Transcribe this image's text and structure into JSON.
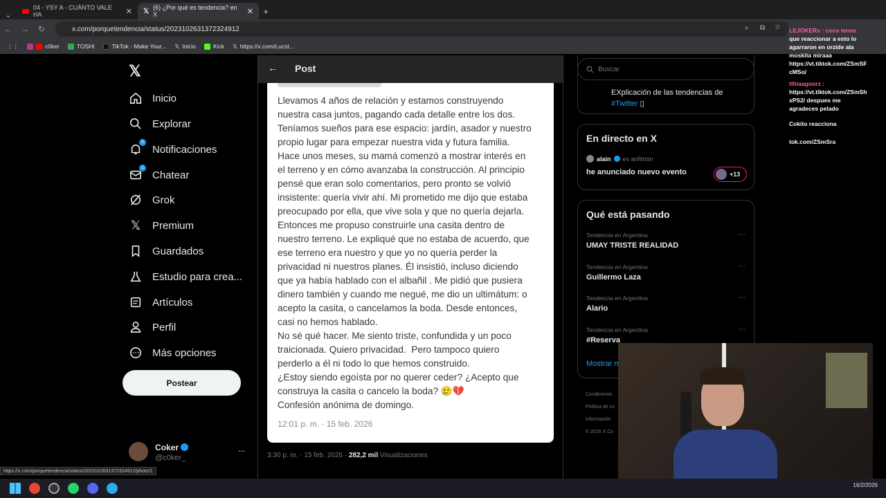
{
  "browser": {
    "tabs": [
      {
        "label": "04 - YSY A - CUÁNTO VALE HA",
        "icon": "youtube-icon"
      },
      {
        "label": "(6) ¿Por qué es tendencia? en X",
        "icon": "x-icon"
      }
    ],
    "new_tab": "+",
    "url": "x.com/porquetendencia/status/2023102631372324912",
    "bookmarks": [
      "c0ker",
      "TOSHI",
      "TikTok - Make Your...",
      "Inicio",
      "Kick",
      "https://x.com/Lucst..."
    ]
  },
  "nav": {
    "items": [
      {
        "label": "Inicio",
        "icon": "home-icon"
      },
      {
        "label": "Explorar",
        "icon": "search-icon"
      },
      {
        "label": "Notificaciones",
        "icon": "bell-icon",
        "badge": "5"
      },
      {
        "label": "Chatear",
        "icon": "mail-icon",
        "badge": "1"
      },
      {
        "label": "Grok",
        "icon": "grok-icon"
      },
      {
        "label": "Premium",
        "icon": "x-icon"
      },
      {
        "label": "Guardados",
        "icon": "bookmark-icon"
      },
      {
        "label": "Estudio para crea...",
        "icon": "flask-icon"
      },
      {
        "label": "Artículos",
        "icon": "article-icon"
      },
      {
        "label": "Perfil",
        "icon": "person-icon"
      },
      {
        "label": "Más opciones",
        "icon": "more-circle-icon"
      }
    ],
    "post_button": "Postear",
    "account": {
      "name": "Coker",
      "handle": "@c0ker_",
      "more": "..."
    }
  },
  "post": {
    "header_title": "Post",
    "body": "Llevamos 4 años de relación y estamos construyendo\nnuestra casa juntos, pagando cada detalle entre los dos.\nTeníamos sueños para ese espacio: jardín, asador y nuestro\npropio lugar para empezar nuestra vida y futura familia.\nHace unos meses, su mamá comenzó a mostrar interés en\nel terreno y en cómo avanzaba la construcción. Al principio\npensé que eran solo comentarios, pero pronto se volvió\ninsistente: quería vivir ahí. Mi prometido me dijo que estaba\npreocupado por ella, que vive sola y que no quería dejarla.\nEntonces me propuso construirle una casita dentro de\nnuestro terreno. Le expliqué que no estaba de acuerdo, que\nese terreno era nuestro y que yo no quería perder la\nprivacidad ni nuestros planes. Él insistió, incluso diciendo\nque ya había hablado con el albañil . Me pidió que pusiera\ndinero también y cuando me negué, me dio un ultimátum: o\nacepto la casita, o cancelamos la boda. Desde entonces,\ncasi no hemos hablado.\nNo sé qué hacer. Me siento triste, confundida y un poco\ntraicionada. Quiero privacidad.  Pero tampoco quiero\nperderlo a él ni todo lo que hemos construido.\n¿Estoy siendo egoísta por no querer ceder? ¿Acepto que\nconstruya la casita o cancelo la boda? 🥲💔\nConfesión anónima de domingo.",
    "image_date": "12:01 p. m. · 15 feb. 2026",
    "meta_time": "3:30 p. m. · 15 feb. 2026 ·",
    "meta_views": "282,2 mil",
    "meta_views_label": "Visualizaciones"
  },
  "sidebar": {
    "search_placeholder": "Buscar",
    "profile_desc": "EXplicación de las tendencias de",
    "profile_link": "#Twitter",
    "live": {
      "title": "En directo en X",
      "host": "alain",
      "host_role": "es anfitrión",
      "event": "he anunciado nuevo evento",
      "count": "+13"
    },
    "trends_title": "Qué está pasando",
    "trends": [
      {
        "category": "Tendencia en Argentina",
        "name": "UMAY TRISTE REALIDAD"
      },
      {
        "category": "Tendencia en Argentina",
        "name": "Guillermo Laza"
      },
      {
        "category": "Tendencia en Argentina",
        "name": "Alario"
      },
      {
        "category": "Tendencia en Argentina",
        "name": "#Reserva"
      }
    ],
    "show_more": "Mostrar m",
    "footer": [
      "Condiciones",
      "Política de co",
      "Información",
      "© 2026 X Co"
    ]
  },
  "stream_chat": [
    "LEJOKERx : coco tenes",
    "que reaccionar a esto lo",
    "agarraron en orzide ala",
    "moskita miraaa",
    "https://vt.tiktok.com/ZSmSF",
    "cMSo/",
    "tthiaagoorz :",
    "https://vt.tiktok.com/ZSmSh",
    "xPS2/ despues me",
    "agradeces pelado",
    "Cokito reacciona",
    "tok.com/ZSmSra"
  ],
  "status_url": "https://x.com/porquetendencia/status/2023102631372324912/photo/1",
  "clock": {
    "date": "16/2/2026"
  }
}
